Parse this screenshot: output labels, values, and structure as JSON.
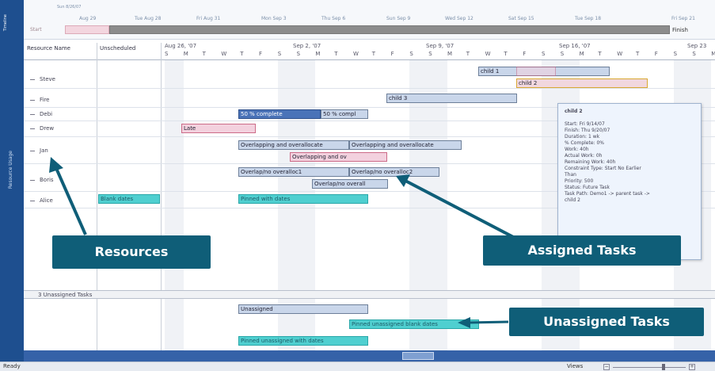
{
  "timeline": {
    "label": "Timeline",
    "start_label": "Start",
    "finish_label": "Finish",
    "top_date": "Sun 8/26/07",
    "dates": [
      "Aug 29",
      "Tue Aug 28",
      "Fri Aug 31",
      "Mon Sep 3",
      "Thu Sep 6",
      "Sun Sep 9",
      "Wed Sep 12",
      "Sat Sep 15",
      "Tue Sep 18",
      "Fri Sep 21"
    ]
  },
  "side_label": "Resource Usage",
  "columns": {
    "resource": "Resource Name",
    "unscheduled": "Unscheduled"
  },
  "weeks": [
    "Aug 26, '07",
    "Sep 2, '07",
    "Sep 9, '07",
    "Sep 16, '07",
    "Sep 23"
  ],
  "days": [
    "S",
    "M",
    "T",
    "W",
    "T",
    "F",
    "S"
  ],
  "resources": [
    "Steve",
    "Fire",
    "Debi",
    "Drew",
    "Jan",
    "Boris",
    "Alice"
  ],
  "bars": {
    "child1": "child 1",
    "child2": "child 2",
    "child3": "child 3",
    "pc50a": "50 % complete",
    "pc50b": "50 % compl",
    "late": "Late",
    "overA": "Overlapping and overallocate",
    "overB": "Overlapping and overallocate",
    "overC": "Overlapping and ov",
    "nonA": "Overlap/no overalloc1",
    "nonB": "Overlap/no overalloc2",
    "nonC": "Overlap/no overall",
    "blank": "Blank dates",
    "pinned": "Pinned with dates",
    "unassigned": "Unassigned",
    "pinnedBlank": "Pinned unassigned blank dates",
    "pinnedUn": "Pinned unassigned with dates"
  },
  "unassigned_header": "3 Unassigned Tasks",
  "tooltip": {
    "title": "child 2",
    "lines": [
      "Start: Fri 9/14/07",
      "Finish: Thu 9/20/07",
      "Duration: 1 wk",
      "% Complete: 0%",
      "Work: 40h",
      "Actual Work: 0h",
      "Remaining Work: 40h",
      "Constraint Type: Start No Earlier",
      "Than",
      "Priority: 500",
      "Status: Future Task",
      "Task Path: Demo1 -> parent task ->",
      "child 2"
    ]
  },
  "callouts": {
    "resources": "Resources",
    "assigned": "Assigned Tasks",
    "unassigned": "Unassigned Tasks"
  },
  "status": {
    "ready": "Ready",
    "views": "Views"
  },
  "colors": {
    "callout": "#0f5e78",
    "side": "#1e4f8f",
    "teal": "#4fcfd0",
    "blue": "#a9c1e6"
  }
}
